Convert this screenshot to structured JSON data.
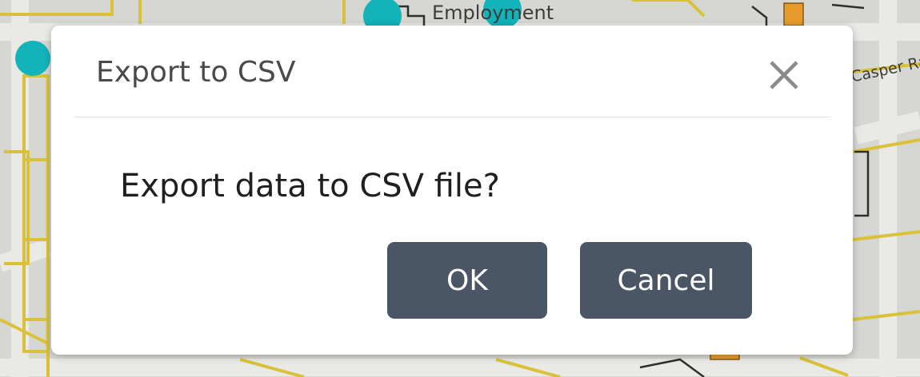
{
  "map": {
    "labels": {
      "building": "Employment",
      "street": "Casper Rai"
    },
    "colors": {
      "background": "#d6d6d2",
      "road": "#e9e9e6",
      "parcel_outline": "#d9c23a",
      "marker": "#13b3ba",
      "highlight_parcel": "#e69a2b"
    }
  },
  "dialog": {
    "title": "Export to CSV",
    "message": "Export data to CSV file?",
    "ok_label": "OK",
    "cancel_label": "Cancel",
    "close_icon": "close-icon",
    "colors": {
      "button_background": "#4a5566",
      "button_text": "#ffffff",
      "title_text": "#4a4a4a",
      "message_text": "#1f1f1f"
    }
  }
}
